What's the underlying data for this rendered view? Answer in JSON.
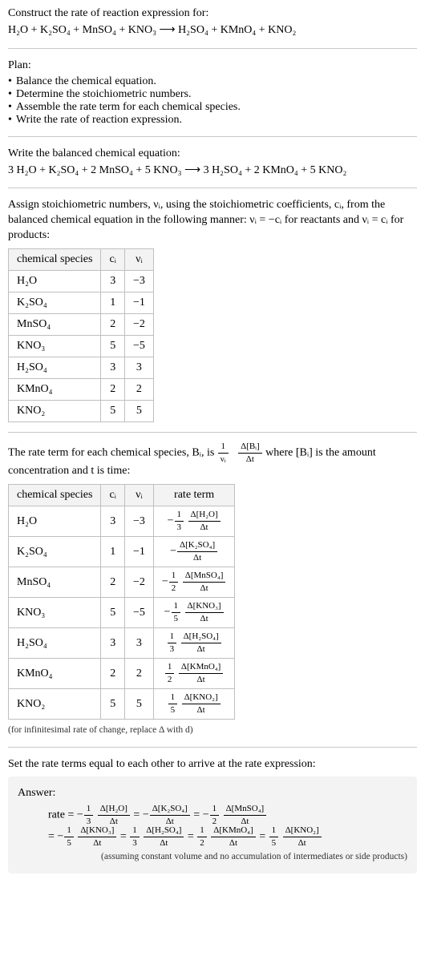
{
  "header": {
    "prompt": "Construct the rate of reaction expression for:",
    "unbalanced_equation": "H₂O + K₂SO₄ + MnSO₄ + KNO₃  ⟶  H₂SO₄ + KMnO₄ + KNO₂"
  },
  "plan": {
    "title": "Plan:",
    "items": [
      "Balance the chemical equation.",
      "Determine the stoichiometric numbers.",
      "Assemble the rate term for each chemical species.",
      "Write the rate of reaction expression."
    ]
  },
  "balanced": {
    "title": "Write the balanced chemical equation:",
    "equation": "3 H₂O + K₂SO₄ + 2 MnSO₄ + 5 KNO₃  ⟶  3 H₂SO₄ + 2 KMnO₄ + 5 KNO₂"
  },
  "stoich_numbers": {
    "intro_a": "Assign stoichiometric numbers, νᵢ, using the stoichiometric coefficients, cᵢ, from the balanced chemical equation in the following manner: νᵢ = −cᵢ for reactants and νᵢ = cᵢ for products:",
    "headers": [
      "chemical species",
      "cᵢ",
      "νᵢ"
    ],
    "rows": [
      {
        "species": "H₂O",
        "c": "3",
        "nu": "−3"
      },
      {
        "species": "K₂SO₄",
        "c": "1",
        "nu": "−1"
      },
      {
        "species": "MnSO₄",
        "c": "2",
        "nu": "−2"
      },
      {
        "species": "KNO₃",
        "c": "5",
        "nu": "−5"
      },
      {
        "species": "H₂SO₄",
        "c": "3",
        "nu": "3"
      },
      {
        "species": "KMnO₄",
        "c": "2",
        "nu": "2"
      },
      {
        "species": "KNO₂",
        "c": "5",
        "nu": "5"
      }
    ]
  },
  "rate_term": {
    "intro_before_frac": "The rate term for each chemical species, Bᵢ, is ",
    "frac1_num": "1",
    "frac1_den": "νᵢ",
    "frac2_num": "Δ[Bᵢ]",
    "frac2_den": "Δt",
    "intro_after_frac": " where [Bᵢ] is the amount concentration and t is time:",
    "headers": [
      "chemical species",
      "cᵢ",
      "νᵢ",
      "rate term"
    ],
    "rows": [
      {
        "species": "H₂O",
        "c": "3",
        "nu": "−3",
        "sign": "−",
        "coef_num": "1",
        "coef_den": "3",
        "delta_num": "Δ[H₂O]",
        "delta_den": "Δt"
      },
      {
        "species": "K₂SO₄",
        "c": "1",
        "nu": "−1",
        "sign": "−",
        "coef_num": "",
        "coef_den": "",
        "delta_num": "Δ[K₂SO₄]",
        "delta_den": "Δt"
      },
      {
        "species": "MnSO₄",
        "c": "2",
        "nu": "−2",
        "sign": "−",
        "coef_num": "1",
        "coef_den": "2",
        "delta_num": "Δ[MnSO₄]",
        "delta_den": "Δt"
      },
      {
        "species": "KNO₃",
        "c": "5",
        "nu": "−5",
        "sign": "−",
        "coef_num": "1",
        "coef_den": "5",
        "delta_num": "Δ[KNO₃]",
        "delta_den": "Δt"
      },
      {
        "species": "H₂SO₄",
        "c": "3",
        "nu": "3",
        "sign": "",
        "coef_num": "1",
        "coef_den": "3",
        "delta_num": "Δ[H₂SO₄]",
        "delta_den": "Δt"
      },
      {
        "species": "KMnO₄",
        "c": "2",
        "nu": "2",
        "sign": "",
        "coef_num": "1",
        "coef_den": "2",
        "delta_num": "Δ[KMnO₄]",
        "delta_den": "Δt"
      },
      {
        "species": "KNO₂",
        "c": "5",
        "nu": "5",
        "sign": "",
        "coef_num": "1",
        "coef_den": "5",
        "delta_num": "Δ[KNO₂]",
        "delta_den": "Δt"
      }
    ],
    "footnote": "(for infinitesimal rate of change, replace Δ with d)"
  },
  "final": {
    "lead": "Set the rate terms equal to each other to arrive at the rate expression:",
    "answer_label": "Answer:",
    "note": "(assuming constant volume and no accumulation of intermediates or side products)",
    "line1": {
      "lead": "rate = ",
      "terms": [
        {
          "sign": "−",
          "coef_num": "1",
          "coef_den": "3",
          "delta_num": "Δ[H₂O]",
          "delta_den": "Δt"
        },
        {
          "sign": "−",
          "coef_num": "",
          "coef_den": "",
          "delta_num": "Δ[K₂SO₄]",
          "delta_den": "Δt"
        },
        {
          "sign": "−",
          "coef_num": "1",
          "coef_den": "2",
          "delta_num": "Δ[MnSO₄]",
          "delta_den": "Δt"
        }
      ]
    },
    "line2": {
      "lead": "= ",
      "terms": [
        {
          "sign": "−",
          "coef_num": "1",
          "coef_den": "5",
          "delta_num": "Δ[KNO₃]",
          "delta_den": "Δt"
        },
        {
          "sign": "",
          "coef_num": "1",
          "coef_den": "3",
          "delta_num": "Δ[H₂SO₄]",
          "delta_den": "Δt"
        },
        {
          "sign": "",
          "coef_num": "1",
          "coef_den": "2",
          "delta_num": "Δ[KMnO₄]",
          "delta_den": "Δt"
        },
        {
          "sign": "",
          "coef_num": "1",
          "coef_den": "5",
          "delta_num": "Δ[KNO₂]",
          "delta_den": "Δt"
        }
      ]
    }
  },
  "chart_data": {
    "type": "table",
    "description": "Stoichiometric coefficients, stoichiometric numbers, and rate terms for each chemical species",
    "columns": [
      "chemical species",
      "c_i",
      "nu_i",
      "rate_term"
    ],
    "rows": [
      {
        "species": "H2O",
        "c_i": 3,
        "nu_i": -3,
        "rate_term": "-(1/3) d[H2O]/dt"
      },
      {
        "species": "K2SO4",
        "c_i": 1,
        "nu_i": -1,
        "rate_term": "- d[K2SO4]/dt"
      },
      {
        "species": "MnSO4",
        "c_i": 2,
        "nu_i": -2,
        "rate_term": "-(1/2) d[MnSO4]/dt"
      },
      {
        "species": "KNO3",
        "c_i": 5,
        "nu_i": -5,
        "rate_term": "-(1/5) d[KNO3]/dt"
      },
      {
        "species": "H2SO4",
        "c_i": 3,
        "nu_i": 3,
        "rate_term": "(1/3) d[H2SO4]/dt"
      },
      {
        "species": "KMnO4",
        "c_i": 2,
        "nu_i": 2,
        "rate_term": "(1/2) d[KMnO4]/dt"
      },
      {
        "species": "KNO2",
        "c_i": 5,
        "nu_i": 5,
        "rate_term": "(1/5) d[KNO2]/dt"
      }
    ],
    "rate_expression": "rate = -(1/3) d[H2O]/dt = - d[K2SO4]/dt = -(1/2) d[MnSO4]/dt = -(1/5) d[KNO3]/dt = (1/3) d[H2SO4]/dt = (1/2) d[KMnO4]/dt = (1/5) d[KNO2]/dt"
  }
}
